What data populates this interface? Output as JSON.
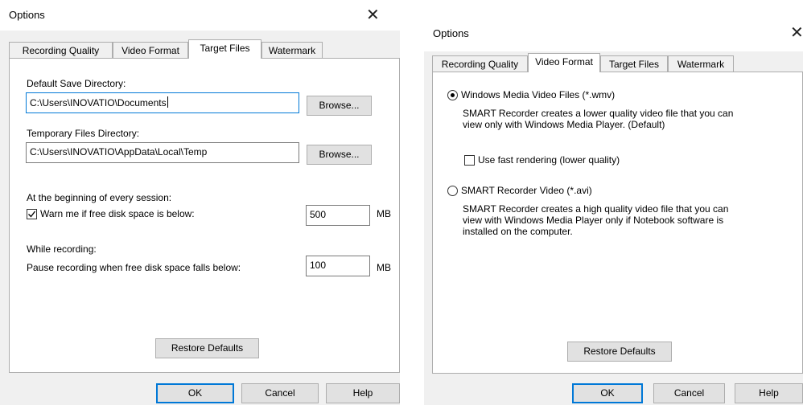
{
  "dialog_left": {
    "title": "Options",
    "tabs": [
      "Recording Quality",
      "Video Format",
      "Target Files",
      "Watermark"
    ],
    "active_tab": "Target Files",
    "default_save_label": "Default Save Directory:",
    "default_save_value": "C:\\Users\\INOVATIO\\Documents",
    "temp_label": "Temporary Files Directory:",
    "temp_value": "C:\\Users\\INOVATIO\\AppData\\Local\\Temp",
    "browse_label": "Browse...",
    "session_label": "At the beginning of every session:",
    "warn_label": "Warn me if free disk space is below:",
    "warn_checked": true,
    "warn_value": "500",
    "unit": "MB",
    "while_recording_label": "While recording:",
    "pause_label": "Pause recording when free disk space falls below:",
    "pause_value": "100",
    "restore_label": "Restore Defaults",
    "ok_label": "OK",
    "cancel_label": "Cancel",
    "help_label": "Help"
  },
  "dialog_right": {
    "title": "Options",
    "tabs": [
      "Recording Quality",
      "Video Format",
      "Target Files",
      "Watermark"
    ],
    "active_tab": "Video Format",
    "wmv_label": "Windows Media Video Files (*.wmv)",
    "wmv_selected": true,
    "wmv_desc_line1": "SMART Recorder creates a lower quality video file that you can",
    "wmv_desc_line2": "view only with Windows Media Player. (Default)",
    "fast_render_label": "Use fast rendering (lower quality)",
    "fast_render_checked": false,
    "avi_label": "SMART Recorder Video (*.avi)",
    "avi_selected": false,
    "avi_desc_line1": "SMART Recorder creates a high quality video file that you can",
    "avi_desc_line2": "view with Windows Media Player only if Notebook software is",
    "avi_desc_line3": "installed on the computer.",
    "restore_label": "Restore Defaults",
    "ok_label": "OK",
    "cancel_label": "Cancel",
    "help_label": "Help"
  },
  "colors": {
    "accent": "#0078d7",
    "dialog_bg": "#f0f0f0",
    "panel_border": "#adadad"
  }
}
